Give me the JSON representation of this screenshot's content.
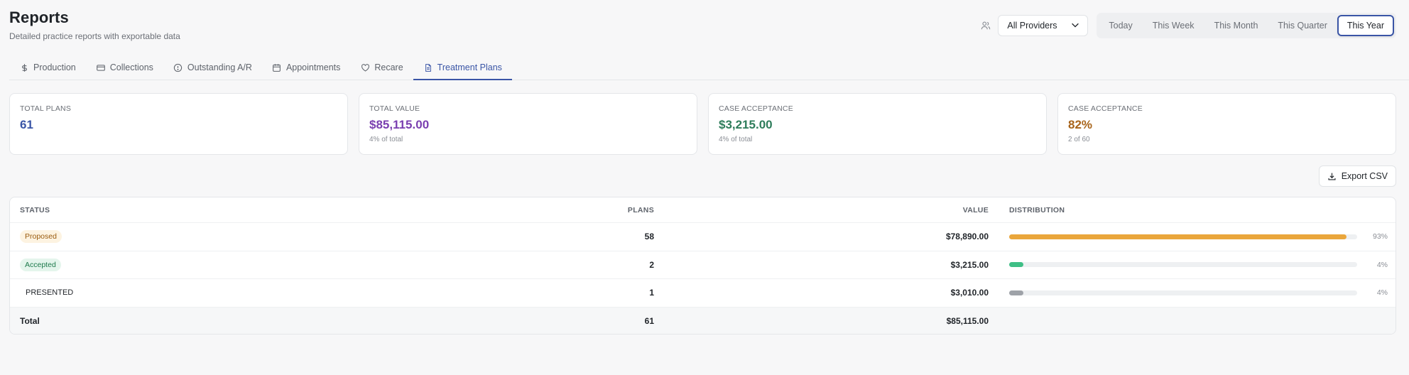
{
  "header": {
    "title": "Reports",
    "subtitle": "Detailed practice reports with exportable data"
  },
  "controls": {
    "provider_icon": "users-icon",
    "provider_select": "All Providers",
    "periods": [
      {
        "label": "Today",
        "active": false
      },
      {
        "label": "This Week",
        "active": false
      },
      {
        "label": "This Month",
        "active": false
      },
      {
        "label": "This Quarter",
        "active": false
      },
      {
        "label": "This Year",
        "active": true
      }
    ]
  },
  "tabs": [
    {
      "label": "Production",
      "icon": "dollar-icon",
      "active": false
    },
    {
      "label": "Collections",
      "icon": "credit-card-icon",
      "active": false
    },
    {
      "label": "Outstanding A/R",
      "icon": "alert-circle-icon",
      "active": false
    },
    {
      "label": "Appointments",
      "icon": "calendar-icon",
      "active": false
    },
    {
      "label": "Recare",
      "icon": "heart-icon",
      "active": false
    },
    {
      "label": "Treatment Plans",
      "icon": "document-icon",
      "active": true
    }
  ],
  "cards": [
    {
      "label": "TOTAL PLANS",
      "value": "61",
      "sub": "",
      "color": "#3a55a6"
    },
    {
      "label": "TOTAL VALUE",
      "value": "$85,115.00",
      "sub": "4% of total",
      "color": "#7a3fb0"
    },
    {
      "label": "CASE ACCEPTANCE",
      "value": "$3,215.00",
      "sub": "4% of total",
      "color": "#2e7d5b"
    },
    {
      "label": "CASE ACCEPTANCE",
      "value": "82%",
      "sub": "2 of 60",
      "color": "#a8641a"
    }
  ],
  "export": {
    "label": "Export CSV",
    "icon": "download-icon"
  },
  "table": {
    "columns": {
      "status": "STATUS",
      "plans": "PLANS",
      "value": "VALUE",
      "distribution": "DISTRIBUTION"
    },
    "rows": [
      {
        "status": "Proposed",
        "badge": "proposed",
        "plans": "58",
        "value": "$78,890.00",
        "pct_label": "93%",
        "fraction": 0.97,
        "color": "#eaa63b"
      },
      {
        "status": "Accepted",
        "badge": "accepted",
        "plans": "2",
        "value": "$3,215.00",
        "pct_label": "4%",
        "fraction": 0.04,
        "color": "#3fbf86"
      },
      {
        "status": "PRESENTED",
        "badge": "presented",
        "plans": "1",
        "value": "$3,010.00",
        "pct_label": "4%",
        "fraction": 0.04,
        "color": "#9ea2a8"
      }
    ],
    "total": {
      "label": "Total",
      "plans": "61",
      "value": "$85,115.00"
    }
  }
}
